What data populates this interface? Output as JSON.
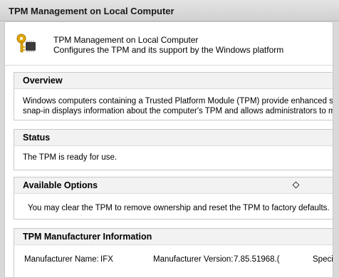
{
  "window": {
    "title": "TPM Management on Local Computer"
  },
  "header": {
    "icon": "tpm-key-chip-icon",
    "line1": "TPM Management on Local Computer",
    "line2": "Configures the TPM and its support by the Windows platform"
  },
  "overview": {
    "heading": "Overview",
    "line1": "Windows computers containing a Trusted Platform Module (TPM) provide enhanced security",
    "line2": "snap-in displays information about the computer's TPM and allows administrators to manage t"
  },
  "status": {
    "heading": "Status",
    "text": "The TPM is ready for use."
  },
  "available_options": {
    "heading": "Available Options",
    "text": "You may clear the TPM to remove ownership and reset the TPM to factory defaults."
  },
  "manufacturer": {
    "heading": "TPM Manufacturer Information",
    "name_label": "Manufacturer Name:",
    "name_value": "IFX",
    "version_label": "Manufacturer Version:",
    "version_value": "7.85.51968.(",
    "spec_label": "Speci"
  },
  "colors": {
    "titlebar": "#d6d6d6",
    "section_header": "#f2f2f2",
    "border": "#c9c9c9"
  }
}
